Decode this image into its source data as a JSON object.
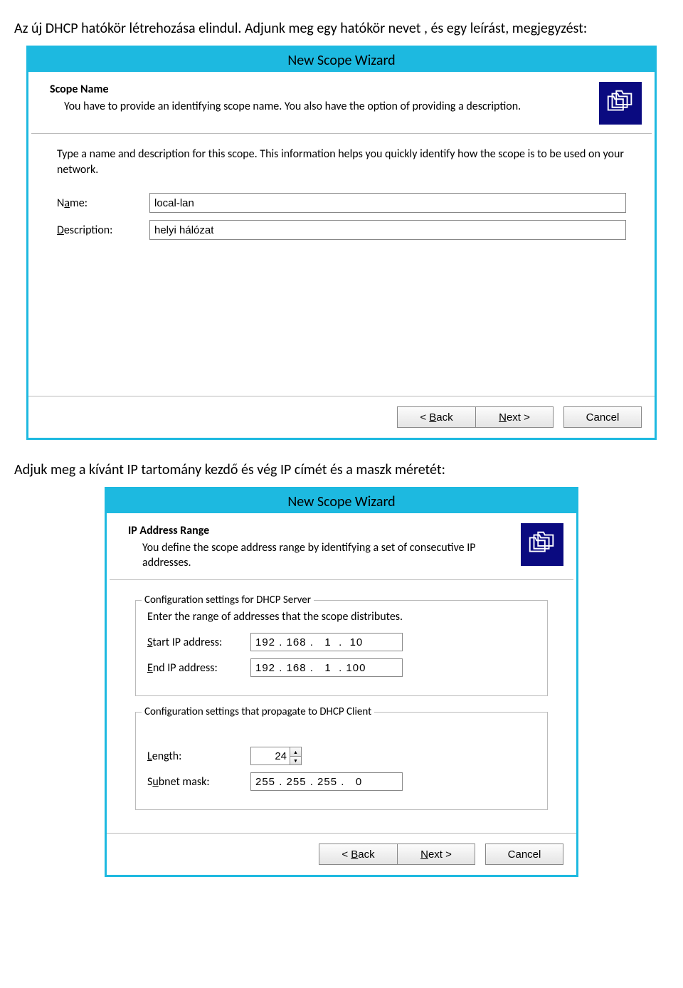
{
  "doc": {
    "intro": "Az új DHCP hatókör létrehozása elindul. Adjunk meg egy hatókör nevet , és egy leírást, megjegyzést:",
    "between": "Adjuk meg a kívánt IP tartomány kezdő és vég IP címét és a maszk méretét:"
  },
  "wiz1": {
    "title": "New Scope Wizard",
    "heading": "Scope Name",
    "subheading": "You have to provide an identifying scope name. You also have the option of providing a description.",
    "instr": "Type a name and description for this scope. This information helps you quickly identify how the scope is to be used on your network.",
    "name_label": "Name:",
    "desc_label": "Description:",
    "name_value": "local-lan",
    "desc_value": "helyi hálózat",
    "back": "< Back",
    "next": "Next >",
    "cancel": "Cancel"
  },
  "wiz2": {
    "title": "New Scope Wizard",
    "heading": "IP Address Range",
    "subheading": "You define the scope address range by identifying a set of consecutive IP addresses.",
    "group1": "Configuration settings for DHCP Server",
    "instr1": "Enter the range of addresses that the scope distributes.",
    "start_label": "Start IP address:",
    "end_label": "End IP address:",
    "start_value": "192 . 168 .   1  .  10",
    "end_value": "192 . 168 .   1  . 100",
    "group2": "Configuration settings that propagate to DHCP Client",
    "length_label": "Length:",
    "length_value": "24",
    "mask_label": "Subnet mask:",
    "mask_value": "255 . 255 . 255 .   0",
    "back": "< Back",
    "next": "Next >",
    "cancel": "Cancel"
  }
}
